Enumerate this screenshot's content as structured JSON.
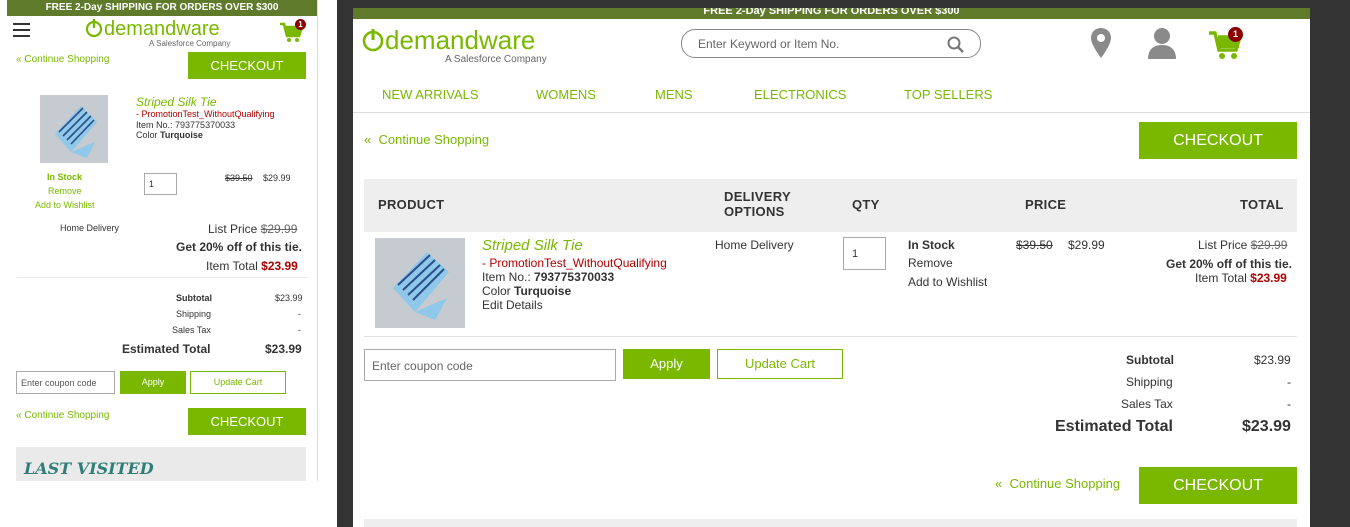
{
  "promo_text": "FREE 2-Day SHIPPING FOR ORDERS OVER $300",
  "brand": {
    "logo_text": "demandware",
    "tagline": "A Salesforce Company"
  },
  "cart_count": "1",
  "search": {
    "placeholder": "Enter Keyword or Item No."
  },
  "nav": [
    "NEW ARRIVALS",
    "WOMENS",
    "MENS",
    "ELECTRONICS",
    "TOP SELLERS"
  ],
  "continue_shopping": "Continue Shopping",
  "checkout_label": "CHECKOUT",
  "table_headers": {
    "product": "PRODUCT",
    "delivery": "DELIVERY OPTIONS",
    "qty": "QTY",
    "price": "PRICE",
    "total": "TOTAL"
  },
  "item": {
    "name": "Striped Silk Tie",
    "promotion": "- PromotionTest_WithoutQualifying",
    "item_no_label": "Item No.:",
    "item_no": "793775370033",
    "color_label": "Color",
    "color": "Turquoise",
    "edit_details": "Edit Details",
    "delivery": "Home Delivery",
    "qty": "1",
    "stock": "In Stock",
    "remove": "Remove",
    "add_to_wishlist": "Add to Wishlist",
    "price_original": "$39.50",
    "price_sale": "$29.99",
    "list_price_label": "List Price",
    "list_price": "$29.99",
    "promo_message": "Get 20% off of this tie.",
    "item_total_label": "Item Total",
    "item_total": "$23.99"
  },
  "summary": {
    "subtotal_label": "Subtotal",
    "subtotal": "$23.99",
    "shipping_label": "Shipping",
    "shipping": "-",
    "tax_label": "Sales Tax",
    "tax": "-",
    "estimated_label": "Estimated Total",
    "estimated": "$23.99"
  },
  "coupon": {
    "placeholder": "Enter coupon code",
    "apply": "Apply",
    "update": "Update Cart"
  },
  "last_visited": "LAST VISITED",
  "colors": {
    "accent": "#7ab800",
    "promo_bar": "#5e7a2a",
    "sale": "#b00000"
  }
}
